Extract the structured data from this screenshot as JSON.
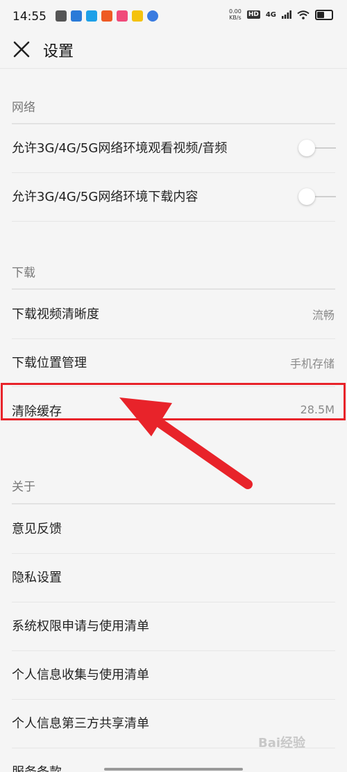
{
  "status_bar": {
    "time": "14:55",
    "net_speed": "0.00",
    "net_speed_unit": "KB/s",
    "hd_badge": "HD",
    "network_type": "4G"
  },
  "header": {
    "title": "设置",
    "close_icon": "close-icon"
  },
  "sections": {
    "network": {
      "label": "网络",
      "items": [
        {
          "label": "允许3G/4G/5G网络环境观看视频/音频",
          "toggle": false
        },
        {
          "label": "允许3G/4G/5G网络环境下载内容",
          "toggle": false
        }
      ]
    },
    "download": {
      "label": "下载",
      "items": [
        {
          "label": "下载视频清晰度",
          "value": "流畅"
        },
        {
          "label": "下载位置管理",
          "value": "手机存储"
        },
        {
          "label": "清除缓存",
          "value": "28.5M"
        }
      ]
    },
    "about": {
      "label": "关于",
      "items": [
        {
          "label": "意见反馈"
        },
        {
          "label": "隐私设置"
        },
        {
          "label": "系统权限申请与使用清单"
        },
        {
          "label": "个人信息收集与使用清单"
        },
        {
          "label": "个人信息第三方共享清单"
        },
        {
          "label": "服务条款"
        }
      ]
    }
  },
  "watermark": "Bai经验",
  "colors": {
    "highlight": "#e8232a",
    "background": "#f5f5f5"
  }
}
